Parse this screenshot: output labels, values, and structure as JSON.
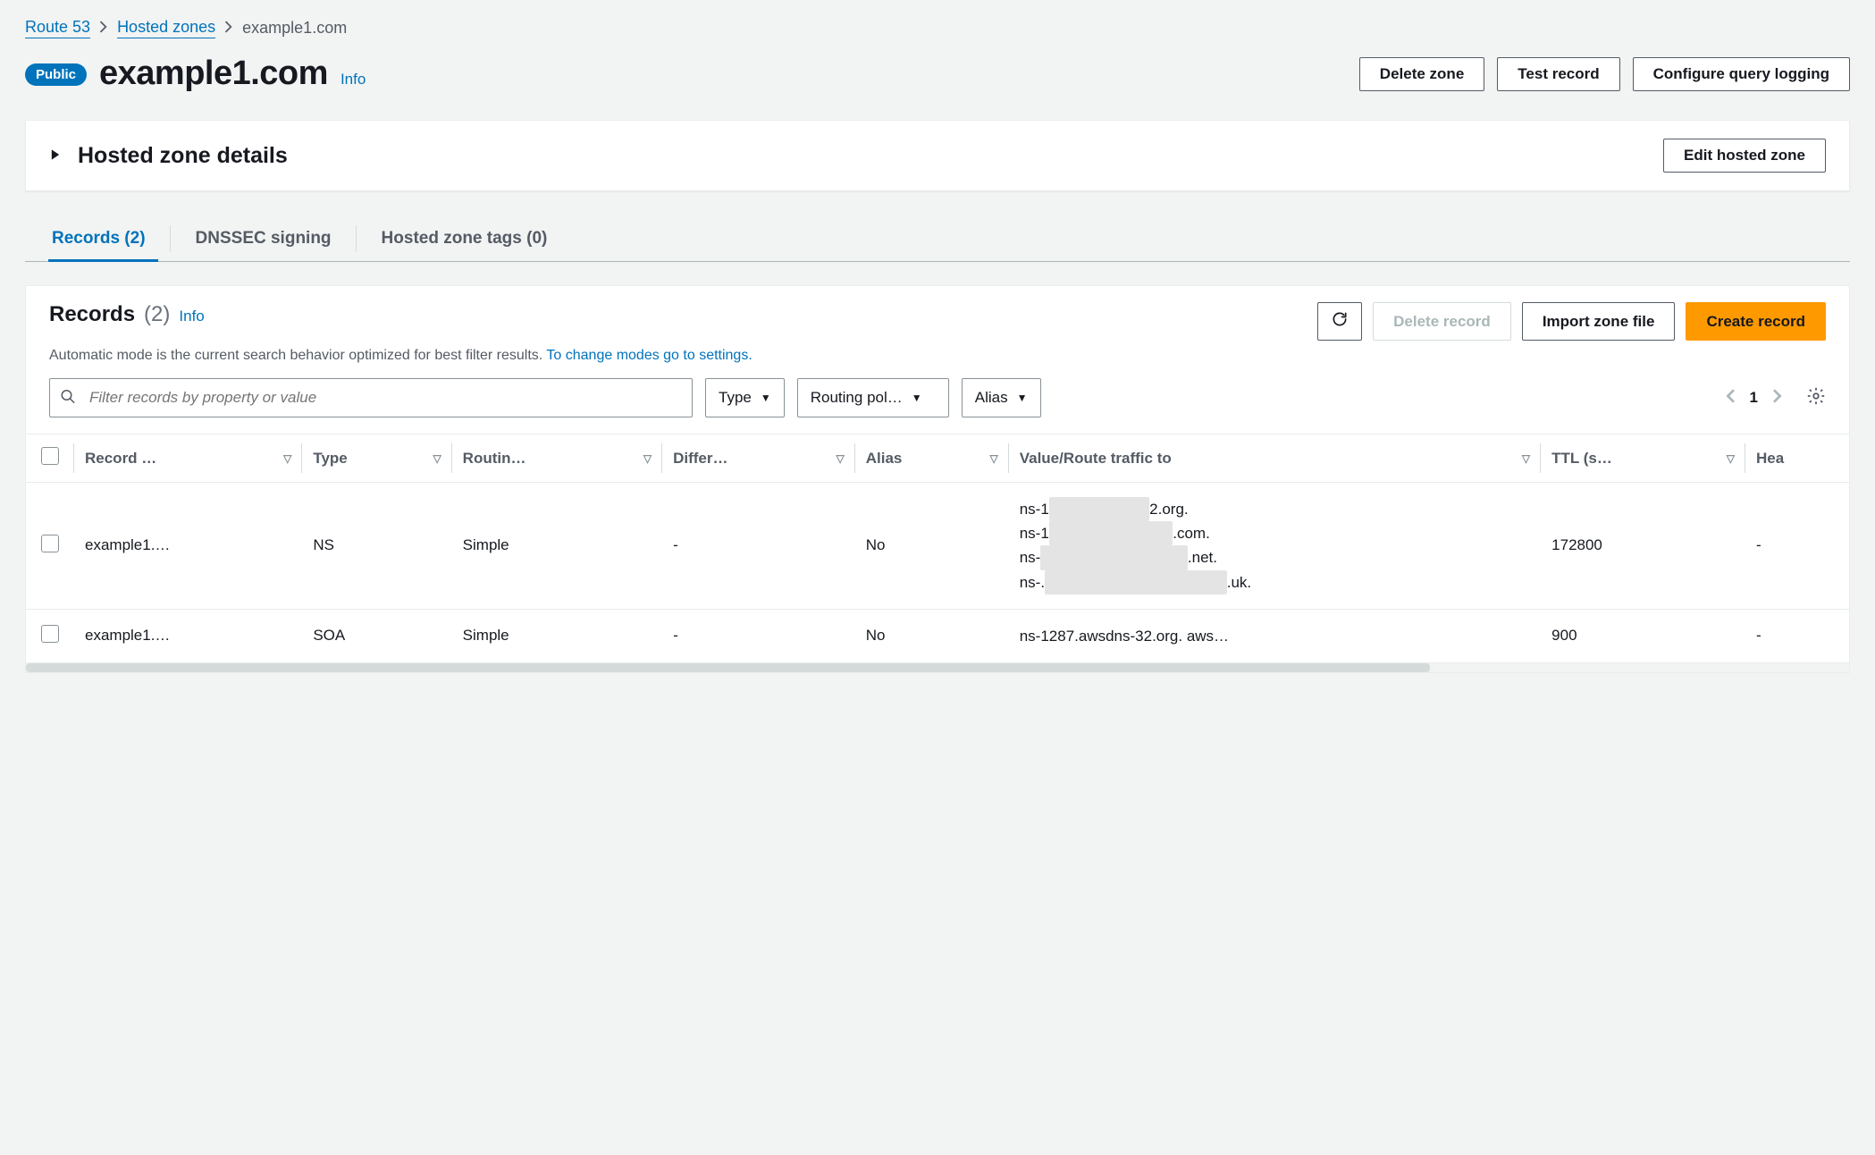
{
  "breadcrumb": {
    "root": "Route 53",
    "zones": "Hosted zones",
    "current": "example1.com"
  },
  "header": {
    "badge": "Public",
    "title": "example1.com",
    "info": "Info",
    "actions": {
      "delete_zone": "Delete zone",
      "test_record": "Test record",
      "configure_logging": "Configure query logging"
    }
  },
  "details_panel": {
    "title": "Hosted zone details",
    "edit": "Edit hosted zone"
  },
  "tabs": {
    "records": "Records (2)",
    "dnssec": "DNSSEC signing",
    "tags": "Hosted zone tags (0)"
  },
  "records": {
    "title": "Records",
    "count": "(2)",
    "info": "Info",
    "actions": {
      "refresh": "Refresh",
      "delete": "Delete record",
      "import": "Import zone file",
      "create": "Create record"
    },
    "desc_text": "Automatic mode is the current search behavior optimized for best filter results. ",
    "desc_link": "To change modes go to settings.",
    "filter": {
      "placeholder": "Filter records by property or value",
      "type": "Type",
      "routing": "Routing pol…",
      "alias": "Alias"
    },
    "pager": {
      "page": "1"
    },
    "columns": {
      "name": "Record …",
      "type": "Type",
      "routing": "Routin…",
      "differ": "Differ…",
      "alias": "Alias",
      "value": "Value/Route traffic to",
      "ttl": "TTL (s…",
      "health": "Hea"
    },
    "rows": [
      {
        "name": "example1.…",
        "type": "NS",
        "routing": "Simple",
        "differ": "-",
        "alias": "No",
        "values": [
          {
            "pre": "ns-1",
            "blur": "████████",
            "post": "2.org."
          },
          {
            "pre": "ns-1",
            "blur": "██████████",
            "post": ".com."
          },
          {
            "pre": "ns-",
            "blur": "████████████",
            "post": ".net."
          },
          {
            "pre": "ns-.",
            "blur": "███████████████",
            "post": ".uk."
          }
        ],
        "ttl": "172800",
        "health": "-"
      },
      {
        "name": "example1.…",
        "type": "SOA",
        "routing": "Simple",
        "differ": "-",
        "alias": "No",
        "values": [
          {
            "pre": "ns-1287.awsdns-32.org. aws…",
            "blur": "",
            "post": ""
          }
        ],
        "ttl": "900",
        "health": "-"
      }
    ]
  }
}
